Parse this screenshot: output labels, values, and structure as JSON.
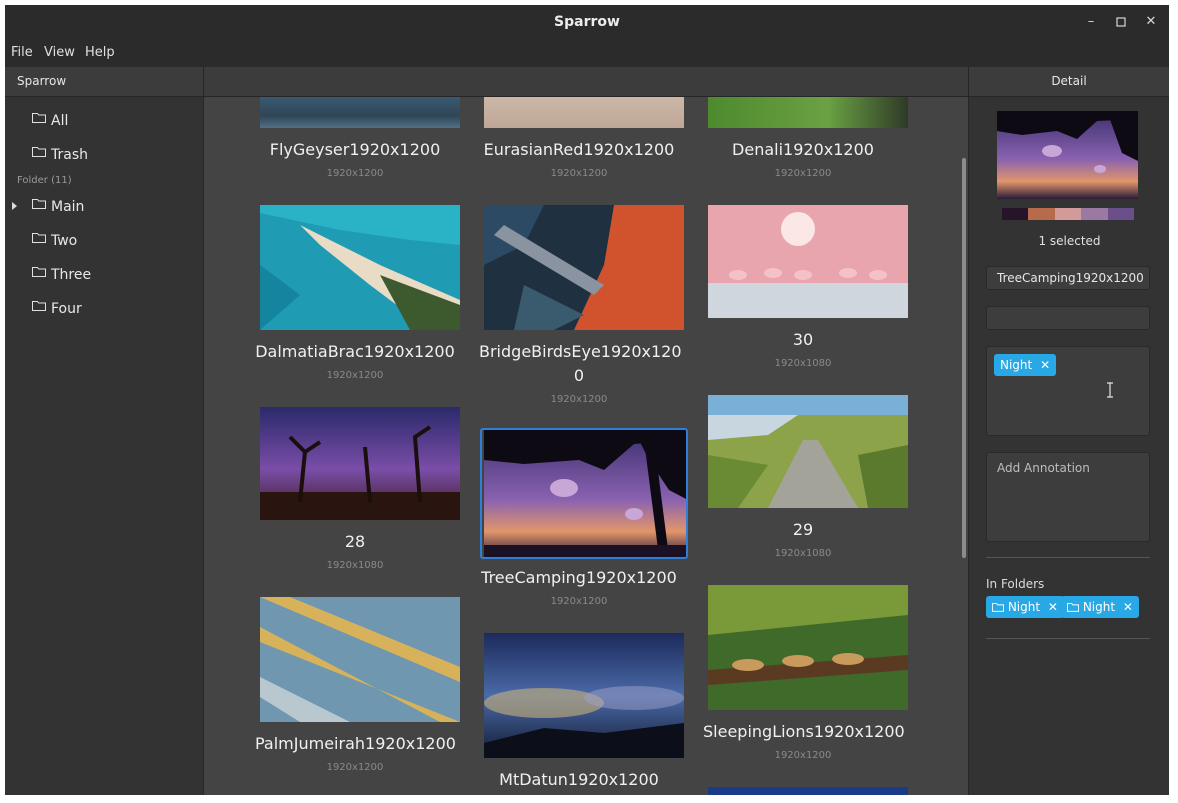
{
  "window": {
    "title": "Sparrow"
  },
  "menu": [
    "File",
    "View",
    "Help"
  ],
  "sidebar": {
    "header": "Sparrow",
    "top_items": [
      {
        "label": "All"
      },
      {
        "label": "Trash"
      }
    ],
    "folder_section_label": "Folder (11)",
    "folders": [
      {
        "label": "Main",
        "expandable": true
      },
      {
        "label": "Two"
      },
      {
        "label": "Three"
      },
      {
        "label": "Four"
      }
    ]
  },
  "content": {
    "items": [
      {
        "name": "FlyGeyser1920x1200",
        "dims": "1920x1200"
      },
      {
        "name": "EurasianRed1920x1200",
        "dims": "1920x1200"
      },
      {
        "name": "Denali1920x1200",
        "dims": "1920x1200"
      },
      {
        "name": "DalmatiaBrac1920x1200",
        "dims": "1920x1200"
      },
      {
        "name": "BridgeBirdsEye1920x1200",
        "name_line1": "BridgeBirdsEye1920x120",
        "name_line2": "0",
        "dims": "1920x1200"
      },
      {
        "name": "30",
        "dims": "1920x1080"
      },
      {
        "name": "28",
        "dims": "1920x1080"
      },
      {
        "name": "TreeCamping1920x1200",
        "dims": "1920x1200",
        "selected": true
      },
      {
        "name": "29",
        "dims": "1920x1080"
      },
      {
        "name": "PalmJumeirah1920x1200",
        "dims": "1920x1200"
      },
      {
        "name": "MtDatun1920x1200",
        "dims": ""
      },
      {
        "name": "SleepingLions1920x1200",
        "dims": "1920x1200"
      }
    ]
  },
  "detail": {
    "header": "Detail",
    "selected_count": "1 selected",
    "palette": [
      "#26152a",
      "#b86a4d",
      "#d39a9a",
      "#9a7aa3",
      "#6a4f8a"
    ],
    "name_value": "TreeCamping1920x1200",
    "second_field_value": "",
    "tags": [
      "Night"
    ],
    "annotation_placeholder": "Add Annotation",
    "in_folders_label": "In Folders",
    "folders": [
      "Night",
      "Night"
    ]
  },
  "colors": {
    "accent": "#29a8e6",
    "selection": "#2f7fd8"
  },
  "icons": [
    "folder-icon",
    "minimize-icon",
    "maximize-icon",
    "close-icon",
    "remove-icon",
    "text-cursor-icon"
  ]
}
